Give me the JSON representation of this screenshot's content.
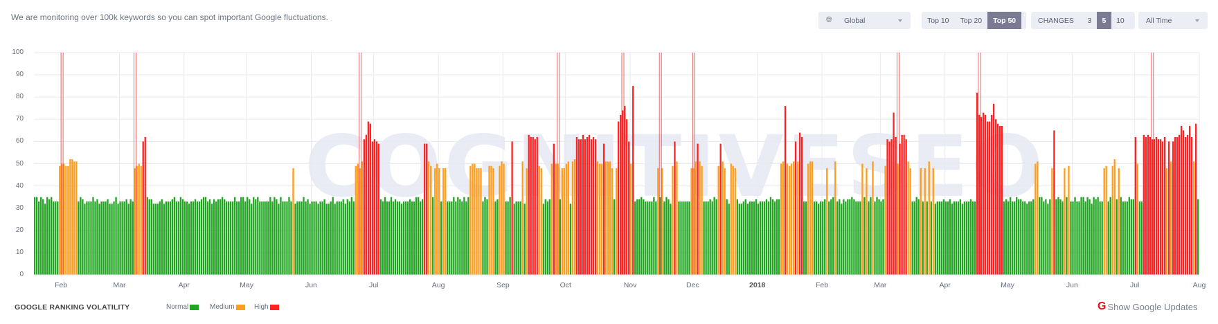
{
  "header": {
    "intro": "We are monitoring over 100k keywords so you can spot important Google fluctuations.",
    "region_select": {
      "icon": "globe-icon",
      "value": "Global"
    },
    "top_tabs": [
      {
        "label": "Top 10",
        "active": false
      },
      {
        "label": "Top 20",
        "active": false
      },
      {
        "label": "Top 50",
        "active": true
      }
    ],
    "changes": {
      "label": "CHANGES",
      "options": [
        {
          "label": "3",
          "active": false
        },
        {
          "label": "5",
          "active": true
        },
        {
          "label": "10",
          "active": false
        }
      ]
    },
    "time_select": {
      "value": "All Time"
    }
  },
  "watermark": "COGNITIVESEO",
  "legend": {
    "title": "GOOGLE RANKING VOLATILITY",
    "items": [
      {
        "label": "Normal",
        "color": "#1fa51f"
      },
      {
        "label": "Medium",
        "color": "#ff9d1c"
      },
      {
        "label": "High",
        "color": "#ff2222"
      }
    ]
  },
  "google_updates_toggle": {
    "icon": "google-g-icon",
    "label": "Show Google Updates"
  },
  "chart_data": {
    "type": "bar",
    "title": "",
    "xlabel": "",
    "ylabel": "",
    "ylim": [
      0,
      100
    ],
    "yticks": [
      0,
      10,
      20,
      30,
      40,
      50,
      60,
      70,
      80,
      90,
      100
    ],
    "grid": true,
    "x_start": "2017-01-19",
    "x_step": "1 day",
    "xticks": [
      {
        "date": "2017-02-01",
        "label": "Feb"
      },
      {
        "date": "2017-03-01",
        "label": "Mar"
      },
      {
        "date": "2017-04-01",
        "label": "Apr"
      },
      {
        "date": "2017-05-01",
        "label": "May"
      },
      {
        "date": "2017-06-01",
        "label": "Jun"
      },
      {
        "date": "2017-07-01",
        "label": "Jul"
      },
      {
        "date": "2017-08-01",
        "label": "Aug"
      },
      {
        "date": "2017-09-01",
        "label": "Sep"
      },
      {
        "date": "2017-10-01",
        "label": "Oct"
      },
      {
        "date": "2017-11-01",
        "label": "Nov"
      },
      {
        "date": "2017-12-01",
        "label": "Dec"
      },
      {
        "date": "2018-01-01",
        "label": "2018"
      },
      {
        "date": "2018-02-01",
        "label": "Feb"
      },
      {
        "date": "2018-03-01",
        "label": "Mar"
      },
      {
        "date": "2018-04-01",
        "label": "Apr"
      },
      {
        "date": "2018-05-01",
        "label": "May"
      },
      {
        "date": "2018-06-01",
        "label": "Jun"
      },
      {
        "date": "2018-07-01",
        "label": "Jul"
      },
      {
        "date": "2018-08-01",
        "label": "Aug"
      }
    ],
    "levels": {
      "Normal": "#1fa51f",
      "Medium": "#ff9d1c",
      "High": "#ff2222"
    },
    "google_updates": [
      "2017-02-01",
      "2017-03-08",
      "2017-06-24",
      "2017-09-27",
      "2017-10-28",
      "2017-11-15",
      "2017-12-01",
      "2018-03-09",
      "2018-04-17",
      "2018-07-09"
    ],
    "values": [
      35,
      35,
      33,
      35,
      34,
      32,
      35,
      34,
      35,
      33,
      33,
      33,
      49,
      50,
      50,
      49,
      49,
      52,
      52,
      51,
      51,
      33,
      35,
      34,
      32,
      33,
      33,
      33,
      35,
      33,
      34,
      32,
      33,
      33,
      33,
      34,
      32,
      32,
      33,
      35,
      32,
      33,
      33,
      33,
      34,
      32,
      34,
      33,
      48,
      49,
      50,
      49,
      60,
      62,
      35,
      34,
      34,
      32,
      32,
      32,
      33,
      34,
      32,
      33,
      33,
      33,
      34,
      35,
      33,
      33,
      35,
      34,
      33,
      33,
      32,
      33,
      33,
      34,
      33,
      33,
      34,
      35,
      35,
      33,
      34,
      32,
      34,
      33,
      34,
      34,
      35,
      34,
      33,
      33,
      33,
      33,
      35,
      33,
      33,
      35,
      35,
      33,
      35,
      34,
      32,
      35,
      34,
      35,
      33,
      33,
      33,
      33,
      33,
      35,
      33,
      35,
      34,
      32,
      35,
      33,
      33,
      33,
      35,
      33,
      48,
      32,
      33,
      33,
      33,
      35,
      33,
      34,
      32,
      33,
      33,
      33,
      32,
      33,
      33,
      34,
      32,
      32,
      33,
      35,
      32,
      33,
      33,
      33,
      34,
      32,
      34,
      33,
      35,
      33,
      49,
      50,
      48,
      51,
      61,
      63,
      69,
      68,
      60,
      61,
      60,
      59,
      34,
      33,
      35,
      33,
      33,
      35,
      33,
      34,
      33,
      33,
      32,
      33,
      33,
      33,
      34,
      33,
      33,
      35,
      35,
      33,
      34,
      59,
      59,
      51,
      49,
      35,
      48,
      50,
      48,
      33,
      48,
      48,
      33,
      33,
      33,
      35,
      33,
      35,
      34,
      33,
      35,
      33,
      35,
      49,
      50,
      50,
      48,
      48,
      48,
      33,
      35,
      34,
      49,
      49,
      48,
      33,
      34,
      49,
      51,
      50,
      33,
      33,
      35,
      60,
      32,
      33,
      33,
      33,
      51,
      32,
      48,
      63,
      62,
      62,
      61,
      62,
      49,
      48,
      32,
      34,
      33,
      34,
      50,
      59,
      50,
      50,
      34,
      48,
      48,
      50,
      51,
      32,
      51,
      52,
      62,
      61,
      61,
      63,
      61,
      62,
      63,
      61,
      62,
      61,
      51,
      50,
      50,
      59,
      51,
      51,
      51,
      48,
      34,
      48,
      69,
      72,
      74,
      76,
      70,
      60,
      50,
      85,
      33,
      34,
      34,
      35,
      34,
      33,
      33,
      33,
      33,
      35,
      33,
      48,
      35,
      48,
      33,
      35,
      34,
      32,
      49,
      60,
      51,
      33,
      33,
      33,
      33,
      33,
      33,
      48,
      48,
      51,
      59,
      51,
      49,
      33,
      33,
      33,
      34,
      33,
      35,
      34,
      49,
      59,
      51,
      48,
      34,
      32,
      50,
      49,
      48,
      34,
      32,
      32,
      33,
      34,
      32,
      33,
      33,
      33,
      34,
      32,
      33,
      33,
      33,
      34,
      33,
      35,
      34,
      33,
      34,
      34,
      50,
      51,
      76,
      50,
      49,
      50,
      51,
      60,
      51,
      64,
      62,
      33,
      33,
      50,
      51,
      51,
      33,
      33,
      32,
      33,
      33,
      34,
      48,
      33,
      34,
      35,
      51,
      33,
      34,
      32,
      34,
      33,
      34,
      34,
      35,
      34,
      33,
      33,
      33,
      50,
      35,
      48,
      33,
      35,
      51,
      33,
      35,
      34,
      33,
      34,
      49,
      61,
      60,
      61,
      73,
      62,
      50,
      59,
      63,
      63,
      61,
      51,
      48,
      33,
      33,
      35,
      34,
      48,
      33,
      48,
      33,
      51,
      33,
      48,
      32,
      33,
      33,
      33,
      34,
      33,
      33,
      34,
      32,
      33,
      33,
      33,
      34,
      32,
      33,
      33,
      33,
      34,
      33,
      33,
      82,
      72,
      71,
      73,
      72,
      69,
      69,
      72,
      77,
      70,
      68,
      67,
      67,
      33,
      34,
      33,
      35,
      33,
      33,
      35,
      34,
      34,
      33,
      33,
      32,
      33,
      33,
      34,
      50,
      51,
      35,
      35,
      33,
      34,
      32,
      34,
      48,
      65,
      34,
      35,
      34,
      33,
      48,
      35,
      49,
      33,
      33,
      35,
      33,
      33,
      35,
      35,
      33,
      35,
      34,
      32,
      35,
      34,
      35,
      33,
      33,
      48,
      49,
      33,
      35,
      49,
      52,
      34,
      48,
      35,
      33,
      33,
      33,
      35,
      34,
      34,
      62,
      50,
      33,
      33,
      63,
      62,
      63,
      62,
      61,
      61,
      62,
      61,
      61,
      60,
      62,
      48,
      60,
      51,
      60,
      62,
      62,
      63,
      67,
      65,
      62,
      63,
      67,
      62,
      51,
      68,
      34
    ]
  }
}
